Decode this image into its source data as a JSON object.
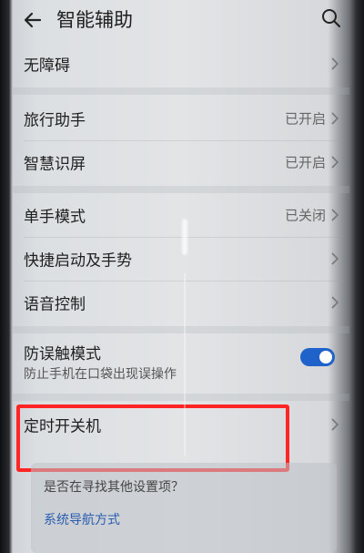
{
  "header": {
    "title": "智能辅助"
  },
  "items": [
    {
      "label": "无障碍",
      "status": ""
    },
    {
      "label": "旅行助手",
      "status": "已开启"
    },
    {
      "label": "智慧识屏",
      "status": "已开启"
    },
    {
      "label": "单手模式",
      "status": "已关闭"
    },
    {
      "label": "快捷启动及手势",
      "status": ""
    },
    {
      "label": "语音控制",
      "status": ""
    }
  ],
  "anti_touch": {
    "label": "防误触模式",
    "description": "防止手机在口袋出现误操作",
    "enabled": true
  },
  "scheduled_power": {
    "label": "定时开关机"
  },
  "suggestion": {
    "question": "是否在寻找其他设置项？",
    "link": "系统导航方式"
  },
  "colors": {
    "toggle_on": "#1f62c9",
    "highlight": "#ff2525",
    "link": "#2a5db0"
  },
  "icons": {
    "back": "arrow-left",
    "search": "magnifier",
    "chevron": "chevron-right"
  }
}
